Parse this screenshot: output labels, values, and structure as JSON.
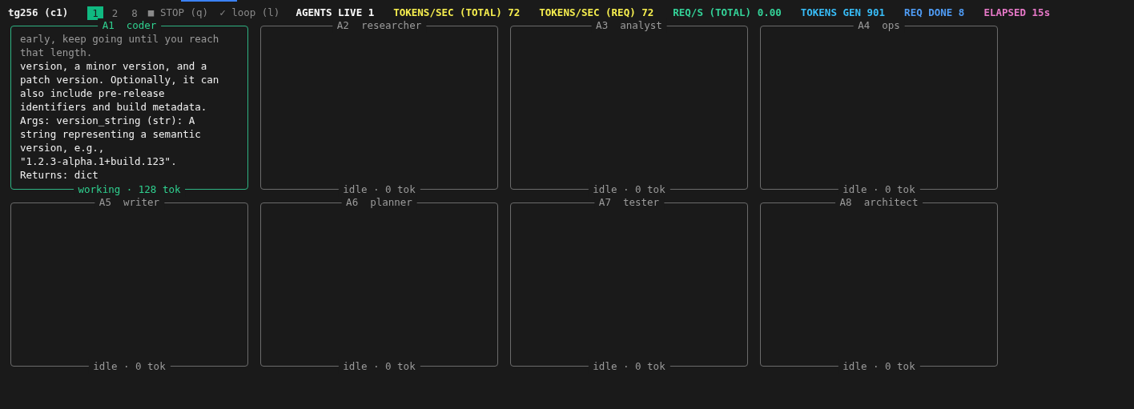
{
  "header": {
    "title": "tg256 (c1)",
    "tabs": [
      {
        "label": "1",
        "selected": true
      },
      {
        "label": "2",
        "selected": false
      },
      {
        "label": "8",
        "selected": false
      }
    ],
    "stop": {
      "icon": "■",
      "label": "STOP (q)"
    },
    "loop": {
      "icon": "✓",
      "label": "loop (l)"
    },
    "stats": [
      {
        "label": "AGENTS LIVE 1",
        "color": "#ffffff"
      },
      {
        "label": "TOKENS/SEC (TOTAL) 72",
        "color": "#f7ef4f"
      },
      {
        "label": "TOKENS/SEC (REQ) 72",
        "color": "#f7ef4f"
      },
      {
        "label": "REQ/S (TOTAL) 0.00",
        "color": "#34d399"
      },
      {
        "label": "TOKENS GEN 901",
        "color": "#38bdf8"
      },
      {
        "label": "REQ DONE 8",
        "color": "#4f9cf5"
      },
      {
        "label": "ELAPSED 15s",
        "color": "#e879c9"
      }
    ]
  },
  "agents": [
    {
      "id": "A1",
      "role": "coder",
      "status": "working · 128 tok",
      "active": true,
      "lines": [
        {
          "text": "early, keep going until you reach",
          "dim": true
        },
        {
          "text": "that length.",
          "dim": true
        },
        {
          "text": "version, a minor version, and a",
          "dim": false
        },
        {
          "text": "patch version. Optionally, it can",
          "dim": false
        },
        {
          "text": "also include pre-release",
          "dim": false
        },
        {
          "text": "identifiers and build metadata.",
          "dim": false
        },
        {
          "text": "Args: version_string (str): A",
          "dim": false
        },
        {
          "text": "string representing a semantic",
          "dim": false
        },
        {
          "text": "version, e.g.,",
          "dim": false
        },
        {
          "text": "\"1.2.3-alpha.1+build.123\".",
          "dim": false
        },
        {
          "text": "Returns: dict",
          "dim": false
        }
      ]
    },
    {
      "id": "A2",
      "role": "researcher",
      "status": "idle · 0 tok",
      "active": false
    },
    {
      "id": "A3",
      "role": "analyst",
      "status": "idle · 0 tok",
      "active": false
    },
    {
      "id": "A4",
      "role": "ops",
      "status": "idle · 0 tok",
      "active": false
    },
    {
      "id": "A5",
      "role": "writer",
      "status": "idle · 0 tok",
      "active": false
    },
    {
      "id": "A6",
      "role": "planner",
      "status": "idle · 0 tok",
      "active": false
    },
    {
      "id": "A7",
      "role": "tester",
      "status": "idle · 0 tok",
      "active": false
    },
    {
      "id": "A8",
      "role": "architect",
      "status": "idle · 0 tok",
      "active": false
    }
  ]
}
